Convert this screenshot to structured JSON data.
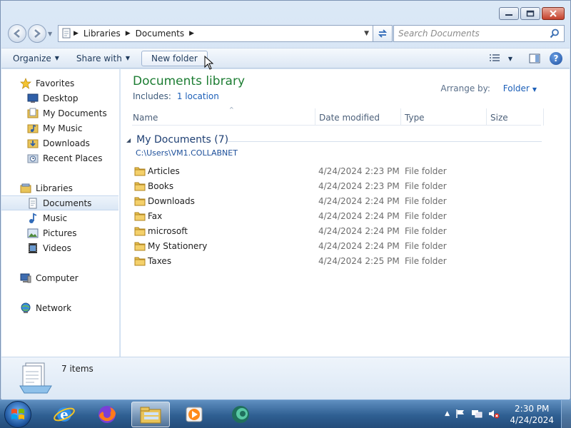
{
  "address": {
    "crumbs": [
      "Libraries",
      "Documents"
    ]
  },
  "search": {
    "placeholder": "Search Documents"
  },
  "toolbar": {
    "organize": "Organize",
    "share_with": "Share with",
    "new_folder": "New folder"
  },
  "nav": {
    "favorites": "Favorites",
    "desktop": "Desktop",
    "my_documents": "My Documents",
    "my_music": "My Music",
    "downloads": "Downloads",
    "recent_places": "Recent Places",
    "libraries": "Libraries",
    "documents": "Documents",
    "music": "Music",
    "pictures": "Pictures",
    "videos": "Videos",
    "computer": "Computer",
    "network": "Network"
  },
  "library": {
    "title": "Documents library",
    "includes_label": "Includes:",
    "includes_link": "1 location",
    "arrange_label": "Arrange by:",
    "arrange_value": "Folder"
  },
  "columns": {
    "name": "Name",
    "date": "Date modified",
    "type": "Type",
    "size": "Size"
  },
  "group": {
    "title": "My Documents (7)",
    "path": "C:\\Users\\VM1.COLLABNET"
  },
  "files": [
    {
      "name": "Articles",
      "date": "4/24/2024 2:23 PM",
      "type": "File folder"
    },
    {
      "name": "Books",
      "date": "4/24/2024 2:23 PM",
      "type": "File folder"
    },
    {
      "name": "Downloads",
      "date": "4/24/2024 2:24 PM",
      "type": "File folder"
    },
    {
      "name": "Fax",
      "date": "4/24/2024 2:24 PM",
      "type": "File folder"
    },
    {
      "name": "microsoft",
      "date": "4/24/2024 2:24 PM",
      "type": "File folder"
    },
    {
      "name": "My Stationery",
      "date": "4/24/2024 2:24 PM",
      "type": "File folder"
    },
    {
      "name": "Taxes",
      "date": "4/24/2024 2:25 PM",
      "type": "File folder"
    }
  ],
  "details": {
    "count": "7 items"
  },
  "clock": {
    "time": "2:30 PM",
    "date": "4/24/2024"
  },
  "colors": {
    "accent_green": "#1d7d33",
    "link_blue": "#1c5fb8",
    "group_blue": "#1e3f73"
  }
}
